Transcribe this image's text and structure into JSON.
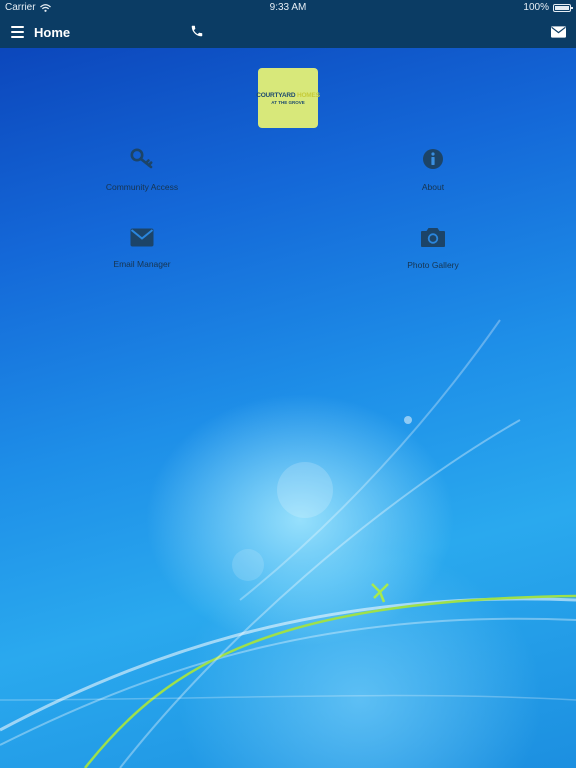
{
  "status_bar": {
    "carrier": "Carrier",
    "time": "9:33 AM",
    "battery": "100%",
    "battery_level": 1.0
  },
  "nav_bar": {
    "title": "Home",
    "icons": {
      "menu": "hamburger-menu-icon",
      "phone": "phone-icon",
      "mail": "envelope-icon"
    }
  },
  "logo": {
    "line1_part1": "COURTYARD ",
    "line1_part2": "HOMES",
    "line2": "AT THE GROVE",
    "background_color": "#d8e87a"
  },
  "tiles": [
    {
      "label": "Community Access",
      "icon": "key-icon"
    },
    {
      "label": "About",
      "icon": "info-icon"
    },
    {
      "label": "Email Manager",
      "icon": "envelope-icon"
    },
    {
      "label": "Photo Gallery",
      "icon": "camera-icon"
    }
  ],
  "colors": {
    "bar_background": "#0b3c64",
    "icon_color": "#1c4468",
    "label_color": "#17344f"
  }
}
